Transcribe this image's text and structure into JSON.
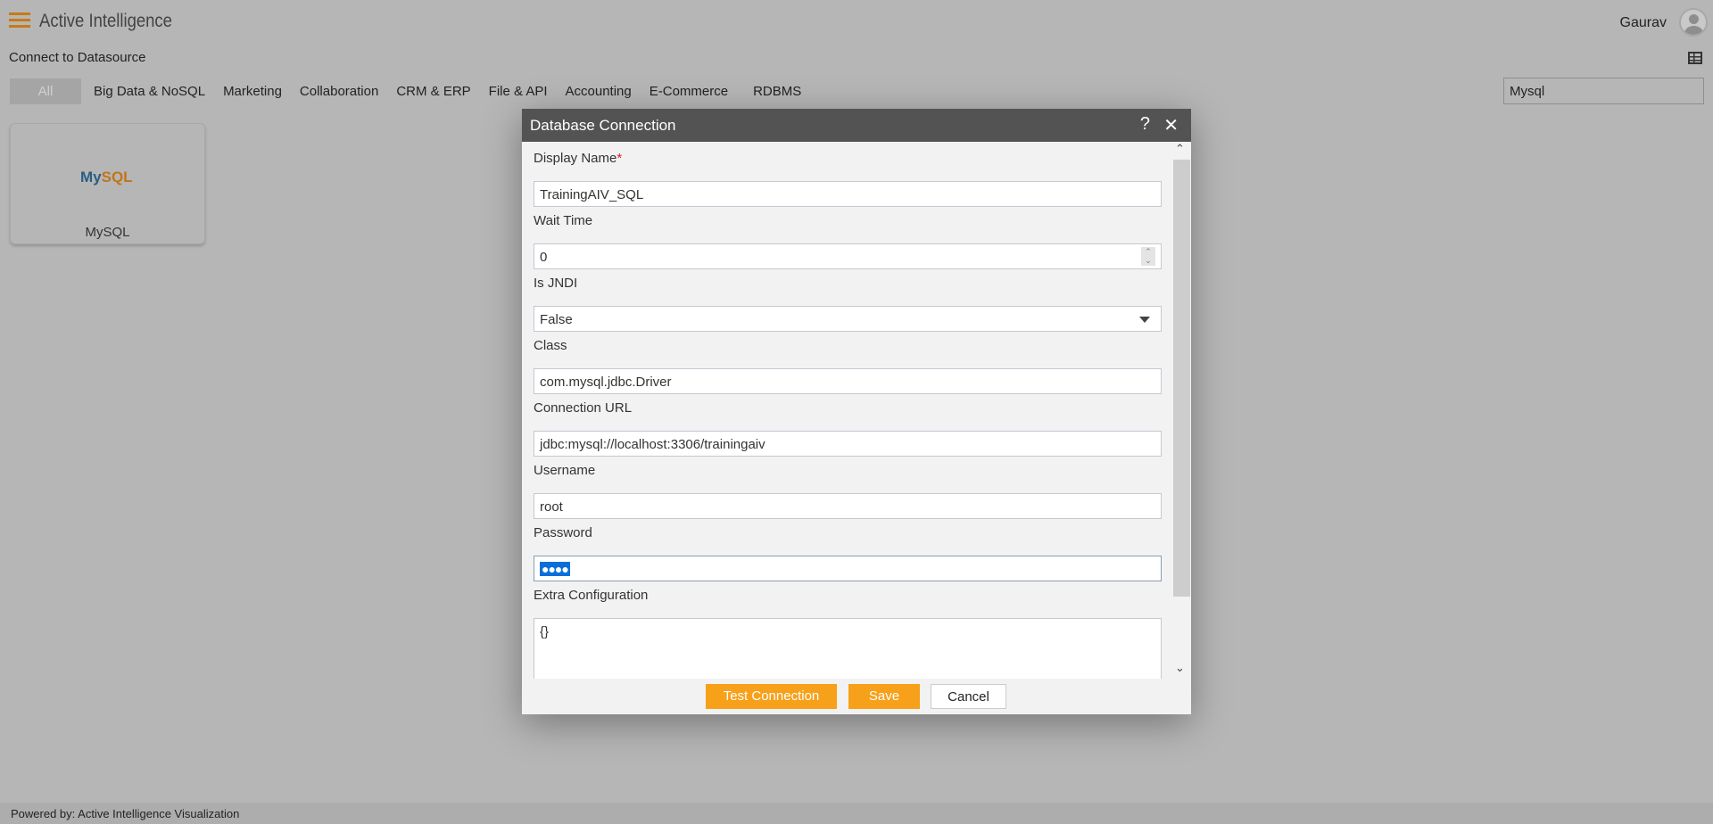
{
  "app": {
    "title": "Active Intelligence",
    "user": "Gaurav",
    "subtitle": "Connect to Datasource",
    "footer": "Powered by: Active Intelligence Visualization"
  },
  "tabs": [
    {
      "label": "All",
      "active": true
    },
    {
      "label": "Big Data & NoSQL"
    },
    {
      "label": "Marketing"
    },
    {
      "label": "Collaboration"
    },
    {
      "label": "CRM & ERP"
    },
    {
      "label": "File & API"
    },
    {
      "label": "Accounting"
    },
    {
      "label": "E-Commerce"
    },
    {
      "label": "RDBMS"
    }
  ],
  "search": {
    "value": "Mysql"
  },
  "cards": [
    {
      "label": "MySQL",
      "logo_my": "My",
      "logo_sql": "SQL"
    }
  ],
  "dialog": {
    "title": "Database Connection",
    "help": "?",
    "close": "✕",
    "fields": [
      {
        "label": "Display Name",
        "required": "*",
        "value": "TrainingAIV_SQL"
      },
      {
        "label": "Wait Time",
        "value": "0"
      },
      {
        "label": "Is JNDI",
        "value": "False"
      },
      {
        "label": "Class",
        "value": "com.mysql.jdbc.Driver"
      },
      {
        "label": "Connection URL",
        "value": "jdbc:mysql://localhost:3306/trainingaiv"
      },
      {
        "label": "Username",
        "value": "root"
      },
      {
        "label": "Password",
        "value": "●●●●"
      },
      {
        "label": "Extra Configuration",
        "value": "{}"
      }
    ],
    "buttons": {
      "test": "Test Connection",
      "save": "Save",
      "cancel": "Cancel"
    }
  },
  "colors": {
    "accent": "#f7a01a",
    "header": "#535353",
    "selection": "#0a6fd8"
  }
}
